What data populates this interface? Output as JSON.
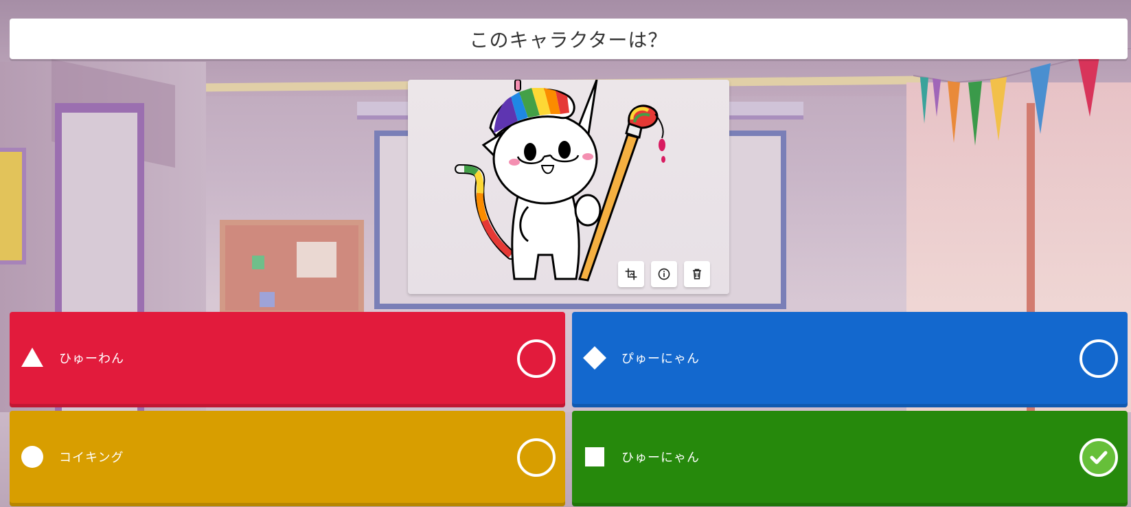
{
  "question": {
    "text": "このキャラクターは？"
  },
  "media": {
    "image_subject": "rainbow-painter-cat-illustration",
    "tools": [
      {
        "name": "crop-icon"
      },
      {
        "name": "info-icon"
      },
      {
        "name": "trash-icon"
      }
    ]
  },
  "answers": [
    {
      "label": "ひゅーわん",
      "shape": "triangle",
      "color": "#e21b3c",
      "correct": false
    },
    {
      "label": "ぴゅーにゃん",
      "shape": "diamond",
      "color": "#1368ce",
      "correct": false
    },
    {
      "label": "コイキング",
      "shape": "circle",
      "color": "#d89e00",
      "correct": false
    },
    {
      "label": "ひゅーにゃん",
      "shape": "square",
      "color": "#26890c",
      "correct": true
    }
  ],
  "colors": {
    "correct_check": "#66bf39"
  }
}
